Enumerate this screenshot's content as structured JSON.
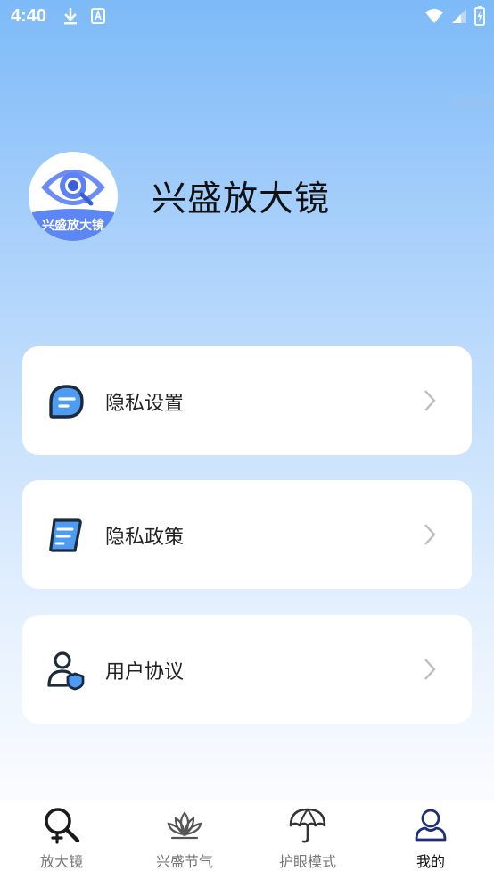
{
  "status_bar": {
    "time": "4:40",
    "icons": [
      "download-icon",
      "keyboard-icon",
      "wifi-icon",
      "signal-icon",
      "battery-icon"
    ]
  },
  "watermark": "5c9bee",
  "app": {
    "logo_text": "兴盛放大镜",
    "name": "兴盛放大镜"
  },
  "menu": {
    "items": [
      {
        "label": "隐私设置",
        "icon": "chat-bubble-icon"
      },
      {
        "label": "隐私政策",
        "icon": "document-icon"
      },
      {
        "label": "用户协议",
        "icon": "user-shield-icon"
      }
    ]
  },
  "bottom_nav": {
    "items": [
      {
        "label": "放大镜",
        "icon": "magnifier-icon",
        "active": false
      },
      {
        "label": "兴盛节气",
        "icon": "lotus-icon",
        "active": false
      },
      {
        "label": "护眼模式",
        "icon": "umbrella-icon",
        "active": false
      },
      {
        "label": "我的",
        "icon": "user-icon",
        "active": true
      }
    ]
  },
  "colors": {
    "accent": "#4f7ef0",
    "active_nav": "#1f2d7a",
    "gradient_top": "#7dbaf8"
  }
}
